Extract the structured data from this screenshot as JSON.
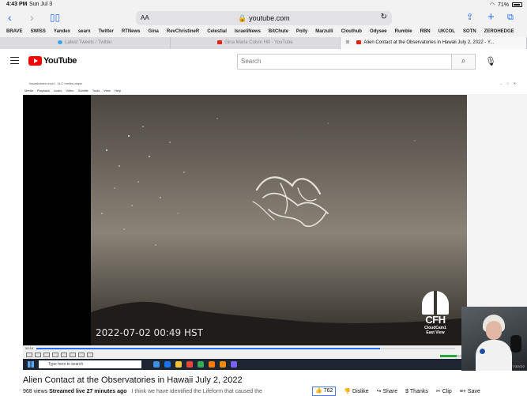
{
  "status_bar": {
    "time": "4:43 PM",
    "date": "Sun Jul 3",
    "battery": "71%"
  },
  "address_bar": {
    "aa": "AA",
    "url": "youtube.com"
  },
  "bookmarks": [
    "BRAVE",
    "SWISS",
    "Yandex",
    "searx",
    "Twitter",
    "RTNews",
    "Gina",
    "RevChristineR",
    "Celestial",
    "IsraeliNews",
    "BitChute",
    "Polly",
    "Marzulli",
    "Clouthub",
    "Odysee",
    "Rumble",
    "RBN",
    "UKCOL",
    "SOTN",
    "ZEROHEDGE"
  ],
  "tabs": [
    {
      "label": "Latest Tweets / Twitter",
      "favicon": "twitter-icon"
    },
    {
      "label": "Gina Maria Colvin Hill - YouTube",
      "favicon": "youtube-icon"
    },
    {
      "label": "Alien Contact at the Observatories in Hawaii July 2, 2022 - Y...",
      "favicon": "youtube-icon",
      "active": true
    }
  ],
  "youtube": {
    "logo_text": "YouTube",
    "search_placeholder": "Search"
  },
  "vlc": {
    "window_title": "hawaiiobserv.mp4 - VLC media player",
    "menu": [
      "Media",
      "Playback",
      "Audio",
      "Video",
      "Subtitle",
      "Tools",
      "View",
      "Help"
    ],
    "elapsed": "00:18",
    "progress": 0.82,
    "timestamp_overlay": "2022-07-02 00:49 HST",
    "cam_brand": "CFH",
    "cam_name": "CloudCam1",
    "cam_view": "East View",
    "taskbar_search": "Type here to search"
  },
  "webcam": {
    "stamp": "7/3/2022"
  },
  "video": {
    "title": "Alien Contact at the Observatories in Hawaii July 2, 2022",
    "views": "968 views",
    "streamed": "Streamed live 27 minutes ago",
    "description": "I think we have identified the Lifeform that caused the",
    "likes": "762",
    "actions": {
      "dislike": "Dislike",
      "share": "Share",
      "thanks": "Thanks",
      "clip": "Clip",
      "save": "Save"
    }
  }
}
